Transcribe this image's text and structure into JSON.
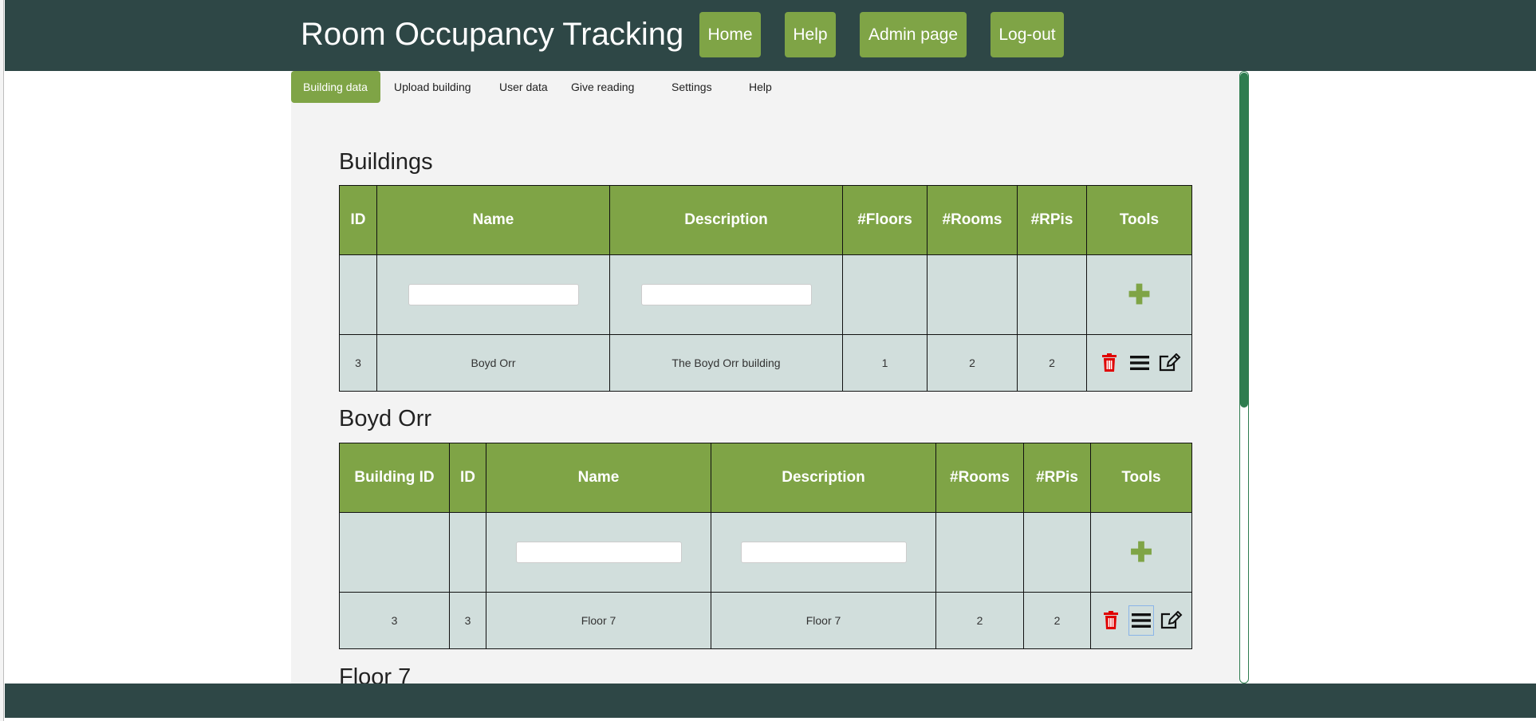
{
  "app": {
    "title": "Room Occupancy Tracking"
  },
  "topnav": {
    "home": "Home",
    "help": "Help",
    "admin": "Admin page",
    "logout": "Log-out"
  },
  "subnav": {
    "building_data": "Building data",
    "upload_building": "Upload building",
    "user_data": "User data",
    "give_reading": "Give reading",
    "settings": "Settings",
    "help": "Help",
    "active": "Building data"
  },
  "buildings": {
    "title": "Buildings",
    "headers": {
      "id": "ID",
      "name": "Name",
      "description": "Description",
      "floors": "#Floors",
      "rooms": "#Rooms",
      "rpis": "#RPis",
      "tools": "Tools"
    },
    "add_icon": "plus-icon",
    "rows": [
      {
        "id": "3",
        "name": "Boyd Orr",
        "description": "The Boyd Orr building",
        "floors": "1",
        "rooms": "2",
        "rpis": "2"
      }
    ]
  },
  "floors": {
    "title": "Boyd Orr",
    "headers": {
      "building_id": "Building ID",
      "id": "ID",
      "name": "Name",
      "description": "Description",
      "rooms": "#Rooms",
      "rpis": "#RPis",
      "tools": "Tools"
    },
    "add_icon": "plus-icon",
    "rows": [
      {
        "building_id": "3",
        "id": "3",
        "name": "Floor 7",
        "description": "Floor 7",
        "rooms": "2",
        "rpis": "2"
      }
    ]
  },
  "rooms": {
    "title": "Floor 7"
  },
  "icons": {
    "delete": "trash-icon",
    "list": "list-icon",
    "edit": "edit-icon"
  },
  "colors": {
    "header_bar": "#2e4746",
    "accent": "#7fa446",
    "cell_bg": "#d1dedc",
    "delete": "#e00000",
    "scrollbar": "#2e7d4f"
  }
}
